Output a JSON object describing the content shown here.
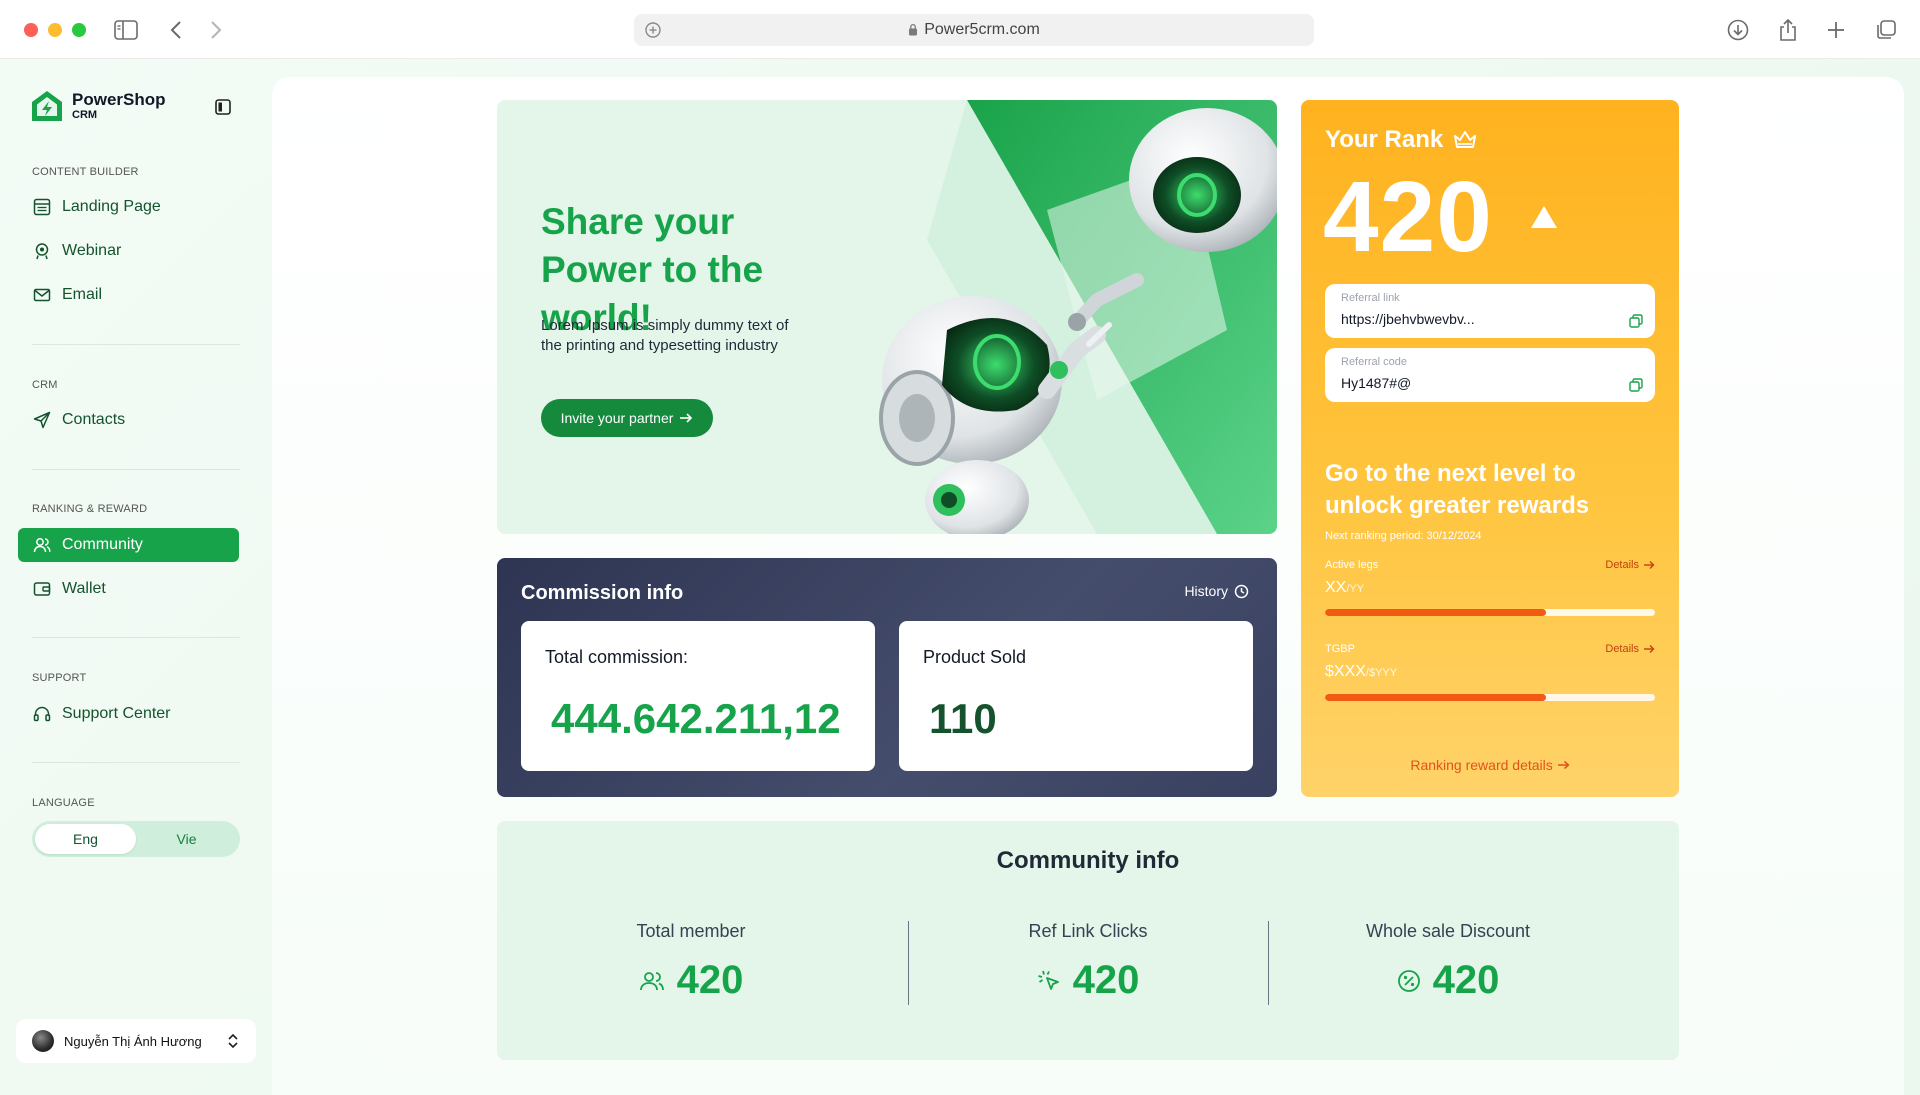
{
  "browser": {
    "url": "Power5crm.com"
  },
  "brand": {
    "title": "PowerShop",
    "subtitle": "CRM",
    "accent": "#16a34a"
  },
  "sidebar": {
    "sections": [
      {
        "label": "CONTENT BUILDER",
        "items": [
          {
            "label": "Landing Page",
            "icon": "layout-icon"
          },
          {
            "label": "Webinar",
            "icon": "webinar-icon"
          },
          {
            "label": "Email",
            "icon": "mail-icon"
          }
        ]
      },
      {
        "label": "CRM",
        "items": [
          {
            "label": "Contacts",
            "icon": "send-icon"
          }
        ]
      },
      {
        "label": "RANKING & REWARD",
        "items": [
          {
            "label": "Community",
            "icon": "users-icon",
            "active": true
          },
          {
            "label": "Wallet",
            "icon": "wallet-icon"
          }
        ]
      },
      {
        "label": "SUPPORT",
        "items": [
          {
            "label": "Support Center",
            "icon": "headset-icon"
          }
        ]
      },
      {
        "label": "LANGUAGE"
      }
    ],
    "language": {
      "options": [
        "Eng",
        "Vie"
      ],
      "selected": "Eng"
    },
    "user": {
      "name": "Nguyễn Thị Ánh Hương"
    }
  },
  "hero": {
    "title": "Share your Power to the world!",
    "description": "Lorem Ipsum is simply dummy text of the printing and typesetting industry",
    "button_label": "Invite your partner"
  },
  "rank": {
    "title": "Your Rank",
    "value": "420",
    "referral_link_label": "Referral link",
    "referral_link_value": "https://jbehvbwevbv...",
    "referral_code_label": "Referral code",
    "referral_code_value": "Hy1487#@",
    "cta": "Go to the next level to unlock greater rewards",
    "period": "Next ranking period: 30/12/2024",
    "metrics": [
      {
        "label": "Active legs",
        "value": "XX",
        "unit": "/YY",
        "details": "Details",
        "progress": 0.67
      },
      {
        "label": "TGBP",
        "value": "$XXX",
        "unit": "/$YYY",
        "details": "Details",
        "progress": 0.67
      }
    ],
    "reward_link": "Ranking reward details"
  },
  "commission": {
    "title": "Commission info",
    "history_label": "History",
    "cards": [
      {
        "label": "Total commission:",
        "value": "444.642.211,12"
      },
      {
        "label": "Product Sold",
        "value": "110"
      }
    ]
  },
  "community": {
    "title": "Community info",
    "stats": [
      {
        "label": "Total member",
        "value": "420",
        "icon": "users-icon"
      },
      {
        "label": "Ref Link Clicks",
        "value": "420",
        "icon": "click-icon"
      },
      {
        "label": "Whole sale Discount",
        "value": "420",
        "icon": "percent-icon"
      }
    ]
  }
}
